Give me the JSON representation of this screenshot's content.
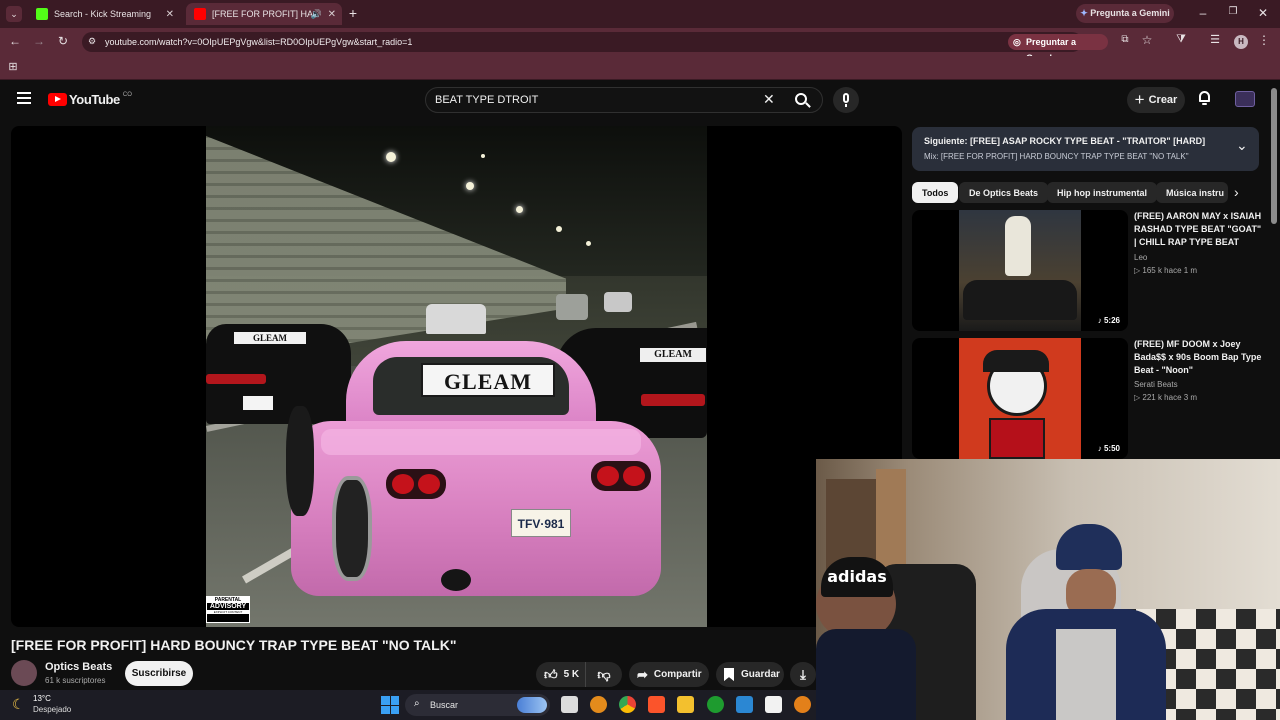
{
  "browser": {
    "tabs": [
      {
        "title": "Search - Kick Streaming",
        "favicon_color": "#53fc18"
      },
      {
        "title": "[FREE FOR PROFIT] HARD B",
        "favicon_color": "#ff0000"
      }
    ],
    "new_tab": "+",
    "gemini_label": "Pregunta a Gemini",
    "url": "youtube.com/watch?v=0OIpUEPgVgw&list=RD0OIpUEPgVgw&start_radio=1",
    "ask_google_label": "Preguntar a Google",
    "profile_initial": "H"
  },
  "youtube": {
    "logo_text": "YouTube",
    "country_code": "CO",
    "search_query": "BEAT TYPE DTROIT",
    "create_label": "Crear"
  },
  "album_art": {
    "plate_sign": "GLEAM",
    "license_plate": "TFV·981",
    "advisory_top": "PARENTAL",
    "advisory_main": "ADVISORY",
    "advisory_bottom": "EXPLICIT CONTENT"
  },
  "video": {
    "title": "[FREE FOR PROFIT] HARD BOUNCY TRAP TYPE BEAT \"NO TALK\"",
    "channel": "Optics Beats",
    "subscribers": "61 k suscriptores",
    "subscribe_label": "Suscribirse",
    "likes": "5 K",
    "share_label": "Compartir",
    "save_label": "Guardar"
  },
  "up_next": {
    "label": "Siguiente:",
    "title": "[FREE] ASAP ROCKY TYPE BEAT - \"TRAITOR\" [HARD]",
    "mix": "Mix: [FREE FOR PROFIT] HARD BOUNCY TRAP TYPE BEAT \"NO TALK\""
  },
  "chips": [
    "Todos",
    "De Optics Beats",
    "Hip hop instrumental",
    "Música instru"
  ],
  "recommendations": [
    {
      "title": "(FREE) AARON MAY x ISAIAH RASHAD TYPE BEAT \"GOAT\" | CHILL RAP TYPE BEAT",
      "channel": "Leo",
      "stats": "165 k  hace 1 m",
      "duration": "5:26"
    },
    {
      "title": "(FREE) MF DOOM x Joey Bada$$ x 90s Boom Bap Type Beat - \"Noon\"",
      "channel": "Serati Beats",
      "stats": "221 k  hace 3 m",
      "duration": "5:50"
    }
  ],
  "webcam": {
    "cap_text": "adidas"
  },
  "taskbar": {
    "weather_temp": "13°C",
    "weather_desc": "Despejado",
    "search_placeholder": "Buscar"
  },
  "colors": {
    "accent_red": "#ff0000",
    "chrome_maroon": "#5a2a38",
    "pink_car": "#e58fd0"
  }
}
